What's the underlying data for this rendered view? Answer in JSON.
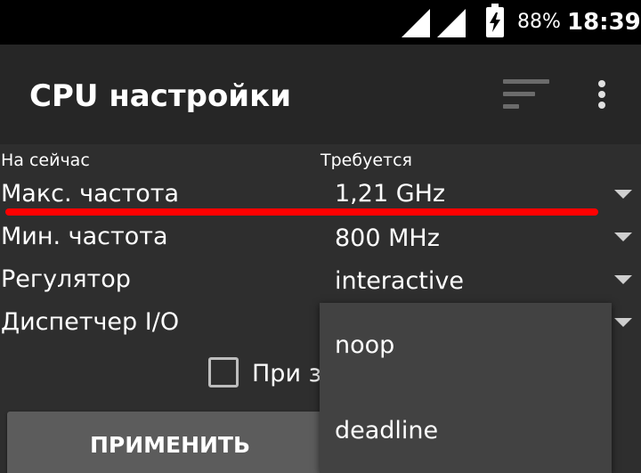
{
  "status_bar": {
    "battery_percent": "88%",
    "time": "18:39",
    "icons": [
      "signal-icon",
      "signal-icon",
      "battery-charging-icon"
    ]
  },
  "app_bar": {
    "title": "CPU настройки",
    "icons": [
      "sort-icon",
      "more-vert-icon"
    ]
  },
  "headers": {
    "current": "На сейчас",
    "required": "Требуется"
  },
  "rows": [
    {
      "label": "Макс. частота",
      "value": "1,21 GHz"
    },
    {
      "label": "Мин. частота",
      "value": "800 MHz"
    },
    {
      "label": "Регулятор",
      "value": "interactive"
    },
    {
      "label": "Диспетчер I/O",
      "value": ""
    }
  ],
  "checkbox": {
    "label": "При за",
    "checked": false
  },
  "apply_button": {
    "label": "ПРИМЕНИТЬ"
  },
  "dropdown": {
    "options": [
      "noop",
      "deadline"
    ]
  },
  "colors": {
    "background": "#2e2e2e",
    "app_bar": "#262626",
    "status_bar": "#000000",
    "highlight_line": "#ff0000",
    "popup": "#424242",
    "button": "#5c5c5c"
  }
}
